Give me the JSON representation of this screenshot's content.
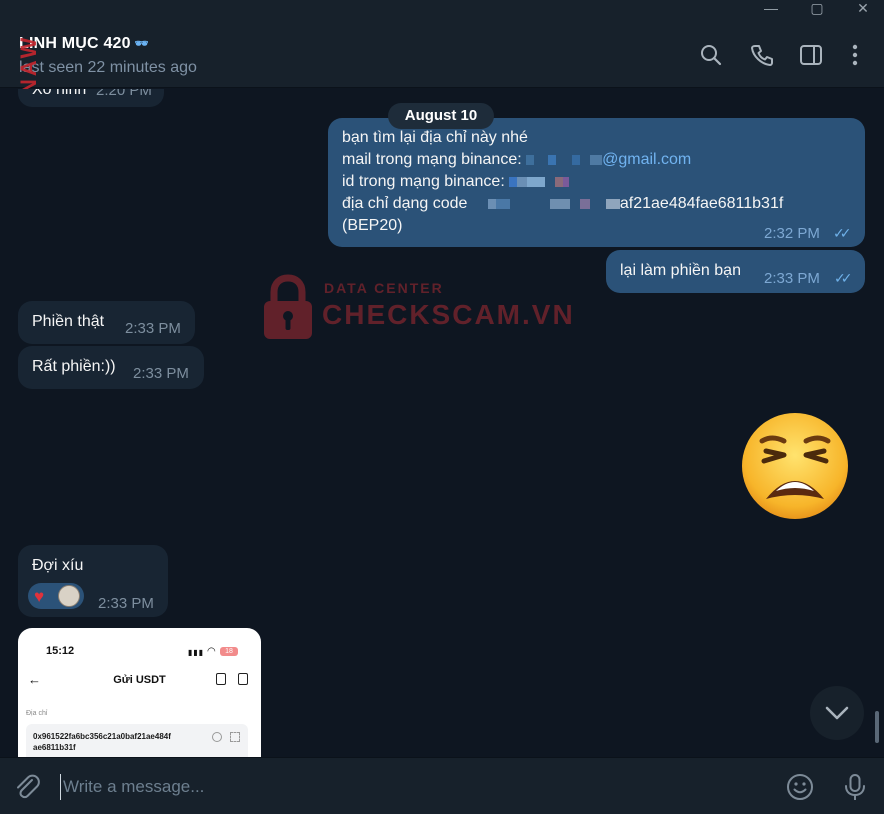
{
  "window": {
    "controls": [
      "minimize",
      "maximize",
      "close"
    ]
  },
  "header": {
    "name": "LINH MỤC 420",
    "badge": "🕶",
    "last_seen": "last seen 22 minutes ago",
    "icons": [
      "search-icon",
      "phone-icon",
      "sidebar-toggle-icon",
      "more-icon"
    ]
  },
  "watermark": {
    "side_text": "NAW",
    "logo_top": "DATA CENTER",
    "logo_bottom": "CHECKSCAM.VN"
  },
  "messages": {
    "partial_top": {
      "text": "Xo hinh",
      "time": "2:20 PM"
    },
    "date_divider": "August 10",
    "out1": {
      "line1": "bạn tìm lại địa chỉ này nhé",
      "line2_prefix": "mail trong mạng binance: ",
      "line2_link": "@gmail.com",
      "line3_prefix": "id trong mạng binance: ",
      "line4_prefix": "địa chỉ dạng code ",
      "line4_suffix": "af21ae484fae6811b31f",
      "line5": "(BEP20)",
      "time": "2:32 PM"
    },
    "out2": {
      "text": "lại làm phiền bạn",
      "time": "2:33 PM"
    },
    "in1": {
      "text": "Phiền thật",
      "time": "2:33 PM"
    },
    "in2": {
      "text": "Rất phiền:))",
      "time": "2:33 PM"
    },
    "in3": {
      "text": "Đợi xíu",
      "time": "2:33 PM",
      "reactions": [
        "heart",
        "user-avatar"
      ]
    },
    "phone_screenshot": {
      "time": "15:12",
      "battery": "18",
      "title": "Gửi USDT",
      "label": "Địa chỉ",
      "address_line1": "0x961522fa6bc356c21a0baf21ae484f",
      "address_line2": "ae6811b31f"
    }
  },
  "composer": {
    "placeholder": "Write a message..."
  },
  "colors": {
    "background": "#0e1621",
    "header": "#17212b",
    "incoming": "#182533",
    "outgoing": "#2b5278",
    "link": "#71b3f0"
  }
}
